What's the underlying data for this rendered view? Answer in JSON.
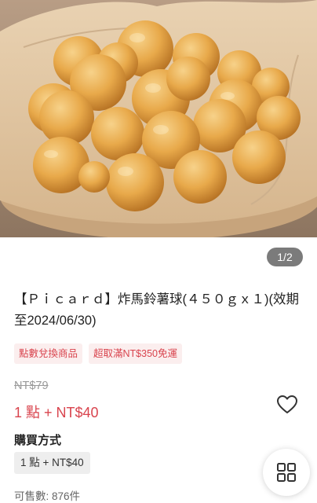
{
  "gallery": {
    "image_alt": "炸馬鈴薯球",
    "pager": "1/2"
  },
  "product": {
    "title": "【Ｐｉｃａｒｄ】炸馬鈴薯球(４５０ｇｘ１)(效期至2024/06/30)",
    "tags": [
      "點數兌換商品",
      "超取滿NT$350免運"
    ],
    "original_price": "NT$79",
    "current_price": "1 點 + NT$40"
  },
  "purchase": {
    "label": "購買方式",
    "option": "1 點 + NT$40",
    "stock": "可售數: 876件"
  },
  "colors": {
    "accent_red": "#d9444e",
    "tag_bg": "#fbeeee"
  },
  "icons": {
    "favorite": "heart-outline-icon",
    "menu": "grid-icon"
  }
}
